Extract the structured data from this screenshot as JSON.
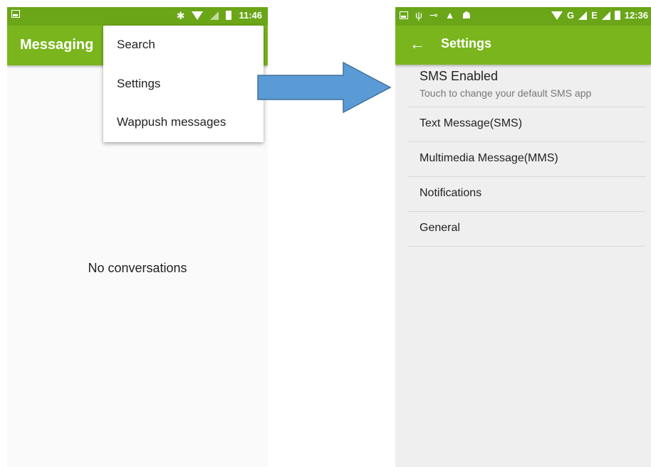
{
  "left_screen": {
    "status_time": "11:46",
    "app_title": "Messaging",
    "empty_text": "No conversations",
    "menu": [
      {
        "label": "Search"
      },
      {
        "label": "Settings"
      },
      {
        "label": "Wappush messages"
      }
    ]
  },
  "right_screen": {
    "status_time": "12:36",
    "network_label": "G",
    "network_label_2": "E",
    "title": "Settings",
    "back_symbol": "←",
    "sms_item": {
      "label": "SMS Enabled",
      "sublabel": "Touch to change your default SMS app"
    },
    "items": [
      {
        "label": "Text Message(SMS)"
      },
      {
        "label": "Multimedia Message(MMS)"
      },
      {
        "label": "Notifications"
      },
      {
        "label": "General"
      }
    ]
  },
  "colors": {
    "status_bar": "#6aa618",
    "app_bar": "#7ab51d",
    "arrow_fill": "#5b9bd5",
    "arrow_stroke": "#41719c"
  },
  "icons": [
    "image-icon",
    "bluetooth-icon",
    "wifi-icon",
    "signal-icon",
    "battery-icon",
    "usb-icon",
    "warning-icon",
    "android-icon",
    "back-arrow-icon",
    "transition-arrow"
  ]
}
